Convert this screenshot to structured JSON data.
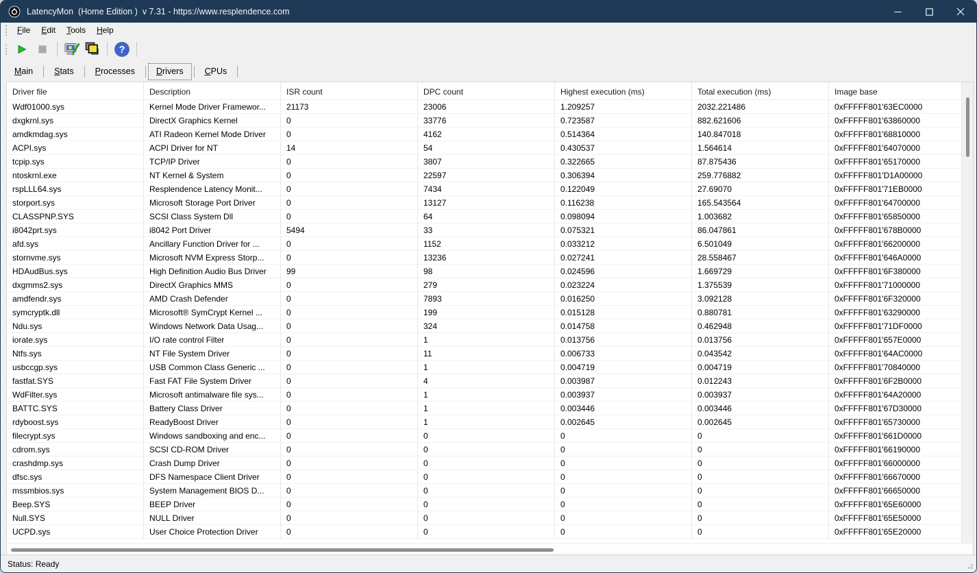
{
  "window": {
    "title": "LatencyMon  (Home Edition )  v 7.31 - https://www.resplendence.com",
    "controls": {
      "minimize": "minimize",
      "maximize": "maximize",
      "close": "close"
    }
  },
  "menu": {
    "items": [
      {
        "key": "F",
        "rest": "ile"
      },
      {
        "key": "E",
        "rest": "dit"
      },
      {
        "key": "T",
        "rest": "ools"
      },
      {
        "key": "H",
        "rest": "elp"
      }
    ]
  },
  "toolbar": {
    "buttons": [
      {
        "icon": "play-icon",
        "name": "start-monitor"
      },
      {
        "icon": "stop-icon",
        "name": "stop-monitor"
      },
      {
        "icon": "monitor-pen-icon",
        "name": "tools"
      },
      {
        "icon": "stacked-windows-icon",
        "name": "windows-stack"
      },
      {
        "icon": "help-icon",
        "name": "help"
      }
    ]
  },
  "tabs": {
    "items": [
      {
        "key": "M",
        "rest": "ain",
        "selected": false
      },
      {
        "key": "S",
        "rest": "tats",
        "selected": false
      },
      {
        "key": "P",
        "rest": "rocesses",
        "selected": false
      },
      {
        "key": "D",
        "rest": "rivers",
        "selected": true
      },
      {
        "key": "C",
        "rest": "PUs",
        "selected": false
      }
    ]
  },
  "table": {
    "columns": [
      {
        "id": "file",
        "label": "Driver file"
      },
      {
        "id": "desc",
        "label": "Description"
      },
      {
        "id": "isr",
        "label": "ISR count"
      },
      {
        "id": "dpc",
        "label": "DPC count"
      },
      {
        "id": "highest",
        "label": "Highest execution (ms)"
      },
      {
        "id": "total",
        "label": "Total execution (ms)"
      },
      {
        "id": "image",
        "label": "Image base"
      }
    ],
    "rows": [
      {
        "file": "Wdf01000.sys",
        "desc": "Kernel Mode Driver Framewor...",
        "isr": "21173",
        "dpc": "23006",
        "highest": "1.209257",
        "total": "2032.221486",
        "image": "0xFFFFF801'63EC0000"
      },
      {
        "file": "dxgkrnl.sys",
        "desc": "DirectX Graphics Kernel",
        "isr": "0",
        "dpc": "33776",
        "highest": "0.723587",
        "total": "882.621606",
        "image": "0xFFFFF801'63860000"
      },
      {
        "file": "amdkmdag.sys",
        "desc": "ATI Radeon Kernel Mode Driver",
        "isr": "0",
        "dpc": "4162",
        "highest": "0.514364",
        "total": "140.847018",
        "image": "0xFFFFF801'68810000"
      },
      {
        "file": "ACPI.sys",
        "desc": "ACPI Driver for NT",
        "isr": "14",
        "dpc": "54",
        "highest": "0.430537",
        "total": "1.564614",
        "image": "0xFFFFF801'64070000"
      },
      {
        "file": "tcpip.sys",
        "desc": "TCP/IP Driver",
        "isr": "0",
        "dpc": "3807",
        "highest": "0.322665",
        "total": "87.875436",
        "image": "0xFFFFF801'65170000"
      },
      {
        "file": "ntoskrnl.exe",
        "desc": "NT Kernel & System",
        "isr": "0",
        "dpc": "22597",
        "highest": "0.306394",
        "total": "259.776882",
        "image": "0xFFFFF801'D1A00000"
      },
      {
        "file": "rspLLL64.sys",
        "desc": "Resplendence Latency Monit...",
        "isr": "0",
        "dpc": "7434",
        "highest": "0.122049",
        "total": "27.69070",
        "image": "0xFFFFF801'71EB0000"
      },
      {
        "file": "storport.sys",
        "desc": "Microsoft Storage Port Driver",
        "isr": "0",
        "dpc": "13127",
        "highest": "0.116238",
        "total": "165.543564",
        "image": "0xFFFFF801'64700000"
      },
      {
        "file": "CLASSPNP.SYS",
        "desc": "SCSI Class System Dll",
        "isr": "0",
        "dpc": "64",
        "highest": "0.098094",
        "total": "1.003682",
        "image": "0xFFFFF801'65850000"
      },
      {
        "file": "i8042prt.sys",
        "desc": "i8042 Port Driver",
        "isr": "5494",
        "dpc": "33",
        "highest": "0.075321",
        "total": "86.047861",
        "image": "0xFFFFF801'678B0000"
      },
      {
        "file": "afd.sys",
        "desc": "Ancillary Function Driver for ...",
        "isr": "0",
        "dpc": "1152",
        "highest": "0.033212",
        "total": "6.501049",
        "image": "0xFFFFF801'66200000"
      },
      {
        "file": "stornvme.sys",
        "desc": "Microsoft NVM Express Storp...",
        "isr": "0",
        "dpc": "13236",
        "highest": "0.027241",
        "total": "28.558467",
        "image": "0xFFFFF801'646A0000"
      },
      {
        "file": "HDAudBus.sys",
        "desc": "High Definition Audio Bus Driver",
        "isr": "99",
        "dpc": "98",
        "highest": "0.024596",
        "total": "1.669729",
        "image": "0xFFFFF801'6F380000"
      },
      {
        "file": "dxgmms2.sys",
        "desc": "DirectX Graphics MMS",
        "isr": "0",
        "dpc": "279",
        "highest": "0.023224",
        "total": "1.375539",
        "image": "0xFFFFF801'71000000"
      },
      {
        "file": "amdfendr.sys",
        "desc": "AMD Crash Defender",
        "isr": "0",
        "dpc": "7893",
        "highest": "0.016250",
        "total": "3.092128",
        "image": "0xFFFFF801'6F320000"
      },
      {
        "file": "symcryptk.dll",
        "desc": "Microsoft® SymCrypt Kernel ...",
        "isr": "0",
        "dpc": "199",
        "highest": "0.015128",
        "total": "0.880781",
        "image": "0xFFFFF801'63290000"
      },
      {
        "file": "Ndu.sys",
        "desc": "Windows Network Data Usag...",
        "isr": "0",
        "dpc": "324",
        "highest": "0.014758",
        "total": "0.462948",
        "image": "0xFFFFF801'71DF0000"
      },
      {
        "file": "iorate.sys",
        "desc": "I/O rate control Filter",
        "isr": "0",
        "dpc": "1",
        "highest": "0.013756",
        "total": "0.013756",
        "image": "0xFFFFF801'657E0000"
      },
      {
        "file": "Ntfs.sys",
        "desc": "NT File System Driver",
        "isr": "0",
        "dpc": "11",
        "highest": "0.006733",
        "total": "0.043542",
        "image": "0xFFFFF801'64AC0000"
      },
      {
        "file": "usbccgp.sys",
        "desc": "USB Common Class Generic ...",
        "isr": "0",
        "dpc": "1",
        "highest": "0.004719",
        "total": "0.004719",
        "image": "0xFFFFF801'70840000"
      },
      {
        "file": "fastfat.SYS",
        "desc": "Fast FAT File System Driver",
        "isr": "0",
        "dpc": "4",
        "highest": "0.003987",
        "total": "0.012243",
        "image": "0xFFFFF801'6F2B0000"
      },
      {
        "file": "WdFilter.sys",
        "desc": "Microsoft antimalware file sys...",
        "isr": "0",
        "dpc": "1",
        "highest": "0.003937",
        "total": "0.003937",
        "image": "0xFFFFF801'64A20000"
      },
      {
        "file": "BATTC.SYS",
        "desc": "Battery Class Driver",
        "isr": "0",
        "dpc": "1",
        "highest": "0.003446",
        "total": "0.003446",
        "image": "0xFFFFF801'67D30000"
      },
      {
        "file": "rdyboost.sys",
        "desc": "ReadyBoost Driver",
        "isr": "0",
        "dpc": "1",
        "highest": "0.002645",
        "total": "0.002645",
        "image": "0xFFFFF801'65730000"
      },
      {
        "file": "filecrypt.sys",
        "desc": "Windows sandboxing and enc...",
        "isr": "0",
        "dpc": "0",
        "highest": "0",
        "total": "0",
        "image": "0xFFFFF801'661D0000"
      },
      {
        "file": "cdrom.sys",
        "desc": "SCSI CD-ROM Driver",
        "isr": "0",
        "dpc": "0",
        "highest": "0",
        "total": "0",
        "image": "0xFFFFF801'66190000"
      },
      {
        "file": "crashdmp.sys",
        "desc": "Crash Dump Driver",
        "isr": "0",
        "dpc": "0",
        "highest": "0",
        "total": "0",
        "image": "0xFFFFF801'66000000"
      },
      {
        "file": "dfsc.sys",
        "desc": "DFS Namespace Client Driver",
        "isr": "0",
        "dpc": "0",
        "highest": "0",
        "total": "0",
        "image": "0xFFFFF801'66670000"
      },
      {
        "file": "mssmbios.sys",
        "desc": "System Management BIOS D...",
        "isr": "0",
        "dpc": "0",
        "highest": "0",
        "total": "0",
        "image": "0xFFFFF801'66650000"
      },
      {
        "file": "Beep.SYS",
        "desc": "BEEP Driver",
        "isr": "0",
        "dpc": "0",
        "highest": "0",
        "total": "0",
        "image": "0xFFFFF801'65E60000"
      },
      {
        "file": "Null.SYS",
        "desc": "NULL Driver",
        "isr": "0",
        "dpc": "0",
        "highest": "0",
        "total": "0",
        "image": "0xFFFFF801'65E50000"
      },
      {
        "file": "UCPD.sys",
        "desc": "User Choice Protection Driver",
        "isr": "0",
        "dpc": "0",
        "highest": "0",
        "total": "0",
        "image": "0xFFFFF801'65E20000"
      }
    ]
  },
  "statusbar": {
    "text": "Status: Ready"
  },
  "colors": {
    "titlebar": "#1e3a56",
    "play_green": "#2eb82e",
    "stop_gray": "#a8a8a8",
    "help_blue": "#3a66cc",
    "stack_yellow": "#f3e13a",
    "grid_line": "#e7e7e7",
    "scroll_thumb": "#8f8f8f"
  }
}
